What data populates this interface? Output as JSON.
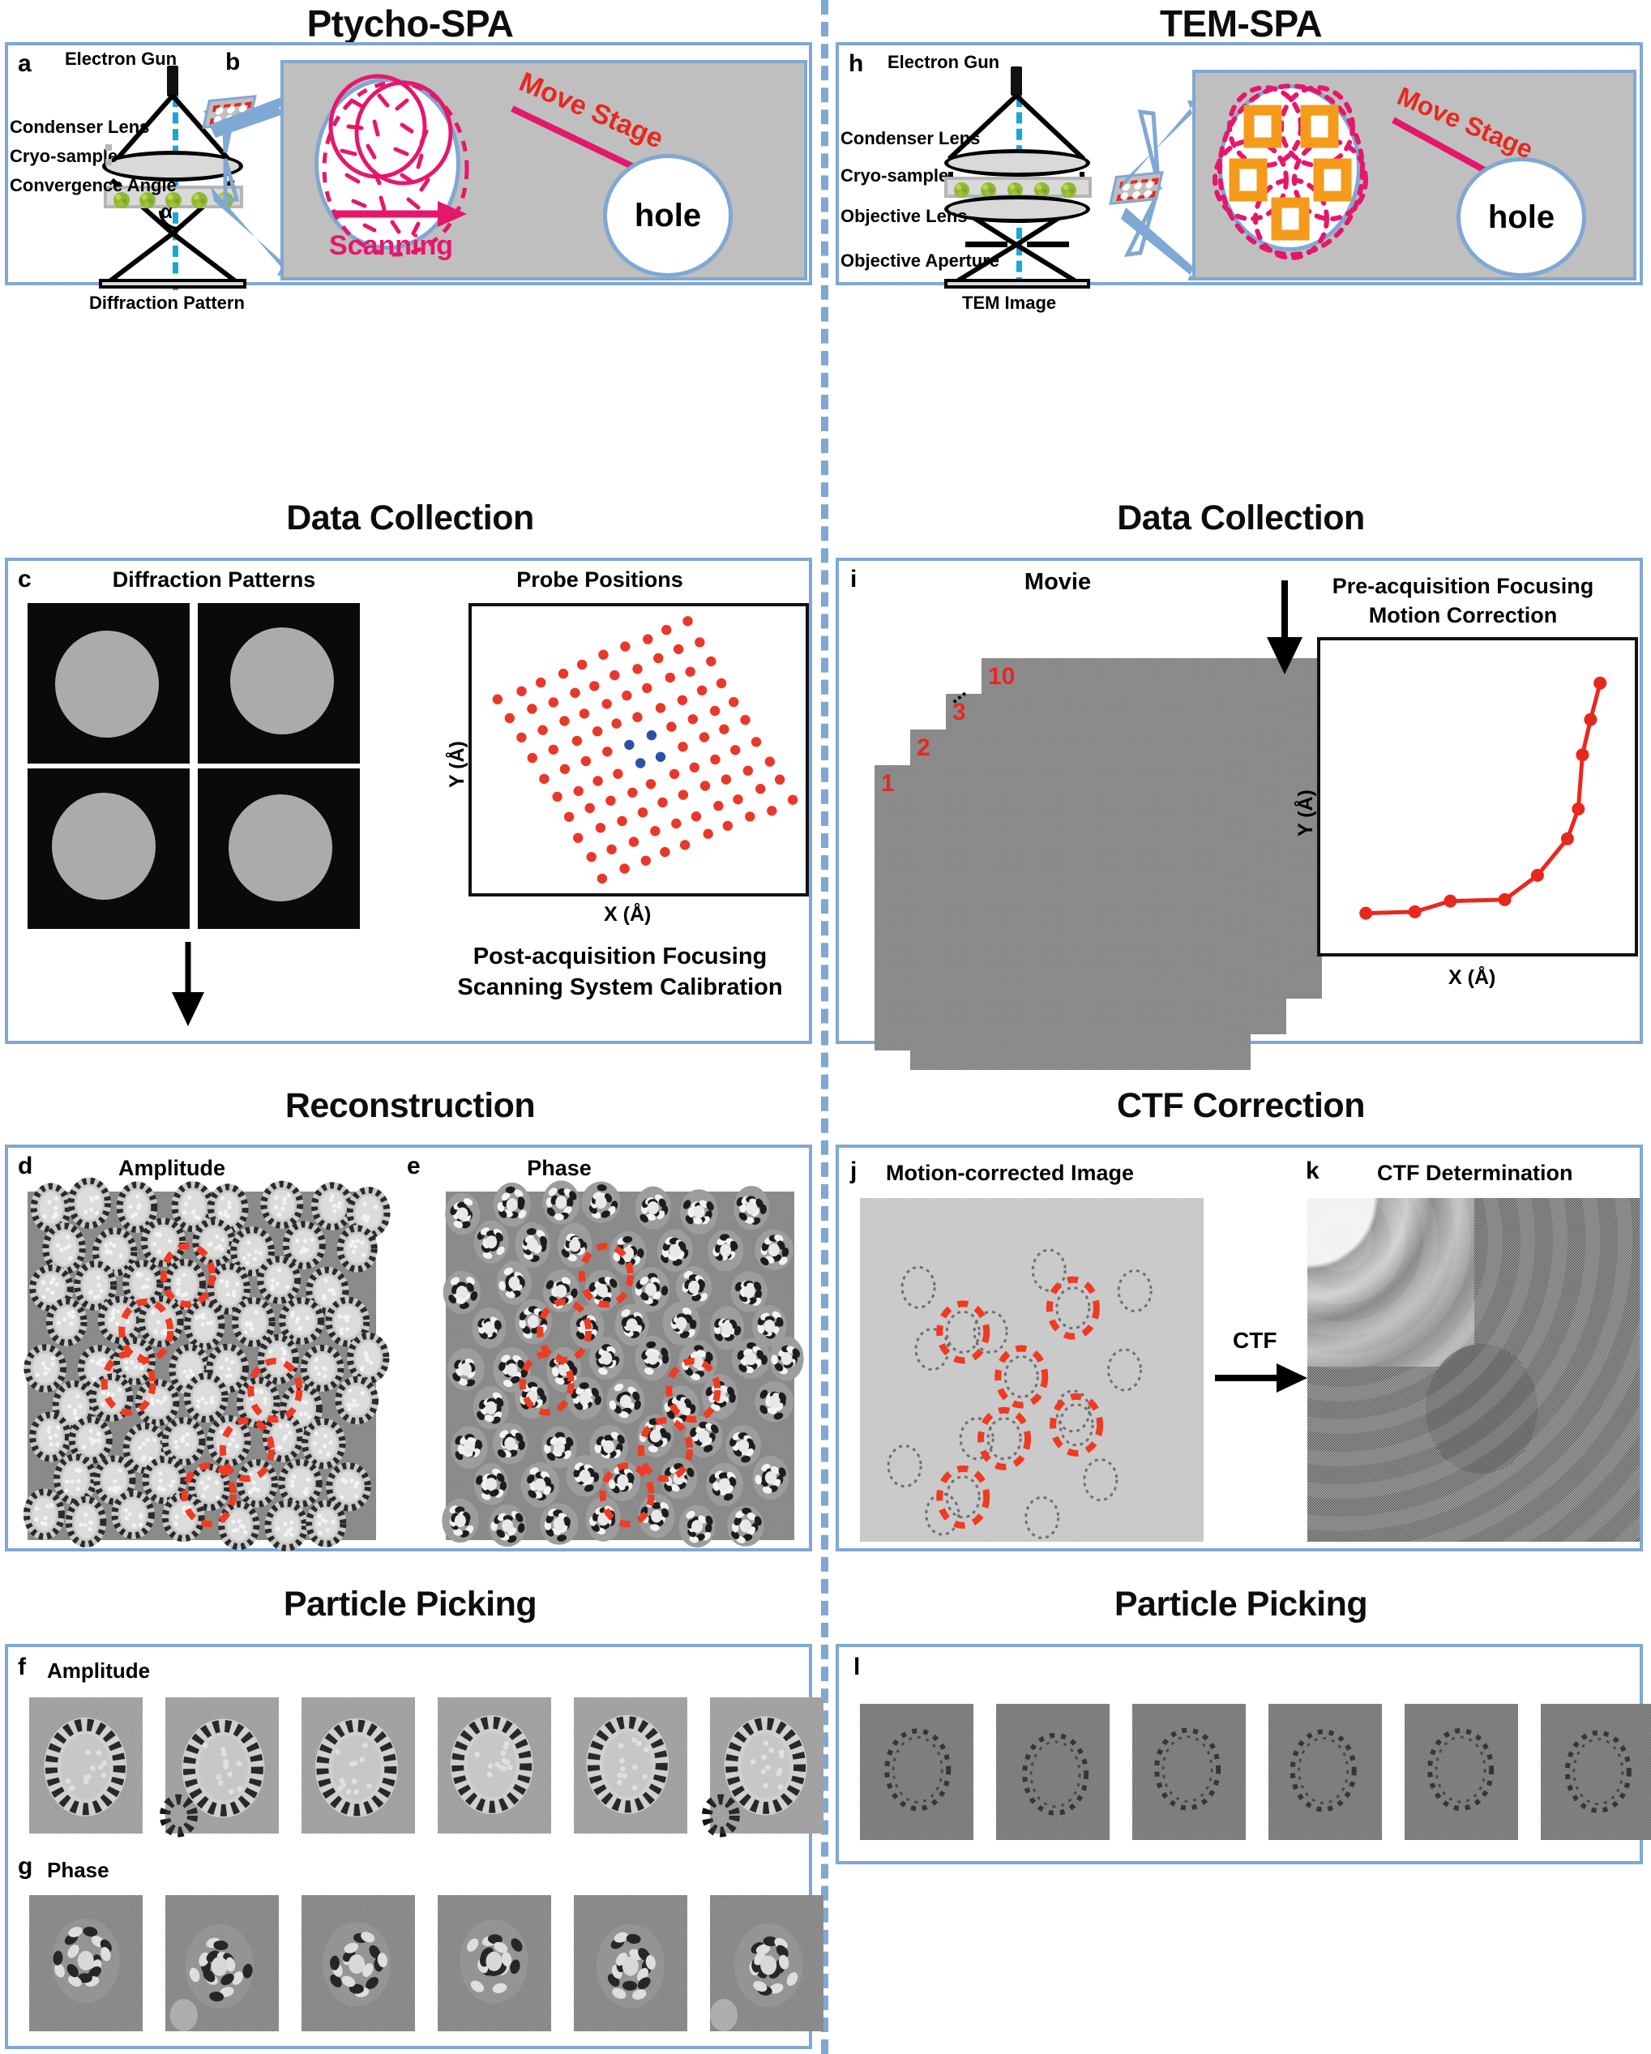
{
  "figure": {
    "columns": [
      {
        "id": "left",
        "title": "Ptycho-SPA",
        "sections": [
          {
            "label": "",
            "panels": [
              "a",
              "b"
            ]
          },
          {
            "label": "Data Collection",
            "panels": [
              "c"
            ]
          },
          {
            "label": "Reconstruction",
            "panels": [
              "d",
              "e"
            ]
          },
          {
            "label": "Particle Picking",
            "panels": [
              "f",
              "g"
            ]
          }
        ]
      },
      {
        "id": "right",
        "title": "TEM-SPA",
        "sections": [
          {
            "label": "",
            "panels": [
              "h"
            ]
          },
          {
            "label": "Data Collection",
            "panels": [
              "i"
            ]
          },
          {
            "label": "CTF Correction",
            "panels": [
              "j",
              "k"
            ]
          },
          {
            "label": "Particle Picking",
            "panels": [
              "l"
            ]
          }
        ]
      }
    ]
  },
  "section_titles": {
    "left_col": "Ptycho-SPA",
    "right_col": "TEM-SPA",
    "left_data_collection": "Data Collection",
    "right_data_collection": "Data Collection",
    "reconstruction": "Reconstruction",
    "ctf_correction": "CTF Correction",
    "left_particle_picking": "Particle Picking",
    "right_particle_picking": "Particle Picking"
  },
  "panel_a": {
    "letter": "a",
    "labels": {
      "electron_gun": "Electron Gun",
      "condenser_lens": "Condenser Lens",
      "cryo_sample": "Cryo-sample",
      "convergence_angle": "Convergence Angle",
      "alpha": "α",
      "detector": "Diffraction Pattern"
    }
  },
  "panel_b": {
    "letter": "b",
    "labels": {
      "move_stage": "Move Stage",
      "scanning": "Scanning",
      "hole": "hole"
    },
    "colors": {
      "arrow": "#E5176B",
      "frame": "#7FA8D4",
      "stage": "#bfbfbf"
    }
  },
  "panel_h": {
    "letter": "h",
    "labels": {
      "electron_gun": "Electron Gun",
      "condenser_lens": "Condenser Lens",
      "cryo_sample": "Cryo-sample",
      "objective_lens": "Objective Lens",
      "objective_aperture": "Objective Aperture",
      "detector": "TEM Image",
      "move_stage": "Move Stage",
      "hole": "hole"
    },
    "colors": {
      "box": "#F59B1C",
      "arrow": "#E5176B"
    }
  },
  "panel_c": {
    "letter": "c",
    "diffraction_title": "Diffraction Patterns",
    "probe_title": "Probe Positions",
    "caption_line1": "Post-acquisition Focusing",
    "caption_line2": "Scanning System Calibration",
    "n_patterns": 4
  },
  "panel_i": {
    "letter": "i",
    "movie_title": "Movie",
    "plot_title_line1": "Pre-acquisition Focusing",
    "plot_title_line2": "Motion Correction",
    "frame_labels": [
      "1",
      "2",
      "3",
      "...",
      "10"
    ]
  },
  "panel_d": {
    "letter": "d",
    "title": "Amplitude"
  },
  "panel_e": {
    "letter": "e",
    "title": "Phase"
  },
  "panel_j": {
    "letter": "j",
    "title": "Motion-corrected Image"
  },
  "panel_k": {
    "letter": "k",
    "title": "CTF Determination",
    "arrow_label": "CTF"
  },
  "panel_f": {
    "letter": "f",
    "title": "Amplitude",
    "n_thumbs": 6
  },
  "panel_g": {
    "letter": "g",
    "title": "Phase",
    "n_thumbs": 6
  },
  "panel_l": {
    "letter": "l",
    "title": "",
    "n_thumbs": 6
  },
  "colors": {
    "panel_border": "#7FA8D4",
    "divider": "#7FA8D4",
    "magenta": "#E5176B",
    "red": "#E8281E",
    "orange": "#F59B1C",
    "cyan_axis": "#17A8D8",
    "particle_green": "#8fb832",
    "pick_circle": "#F03A21",
    "probe_red": "#E8382B",
    "probe_blue": "#2E4FA8"
  },
  "chart_data": [
    {
      "type": "scatter",
      "title": "Probe Positions",
      "xlabel": "X (Å)",
      "ylabel": "Y (Å)",
      "grid": false,
      "legend": "none",
      "description": "Rotated 10x10 raster of scan probe positions; four central points highlighted blue",
      "series": [
        {
          "name": "probe positions",
          "color": "#E8382B",
          "n_points": 96
        },
        {
          "name": "highlighted probes",
          "color": "#2E4FA8",
          "n_points": 4,
          "points": [
            [
              0.5,
              0.565
            ],
            [
              0.565,
              0.53
            ],
            [
              0.455,
              0.495
            ],
            [
              0.53,
              0.465
            ]
          ]
        }
      ],
      "grid_params": {
        "rows": 10,
        "cols": 10,
        "rotation_deg": -22,
        "shear_deg": 8
      }
    },
    {
      "type": "line",
      "title": "Pre-acquisition Focusing / Motion Correction",
      "xlabel": "X (Å)",
      "ylabel": "Y (Å)",
      "grid": false,
      "legend": "none",
      "marker": "circle",
      "color": "#E8281E",
      "x": [
        0.09,
        0.27,
        0.4,
        0.6,
        0.72,
        0.83,
        0.87,
        0.885,
        0.915,
        0.95
      ],
      "y": [
        0.07,
        0.075,
        0.115,
        0.12,
        0.21,
        0.345,
        0.455,
        0.655,
        0.785,
        0.92
      ]
    }
  ]
}
